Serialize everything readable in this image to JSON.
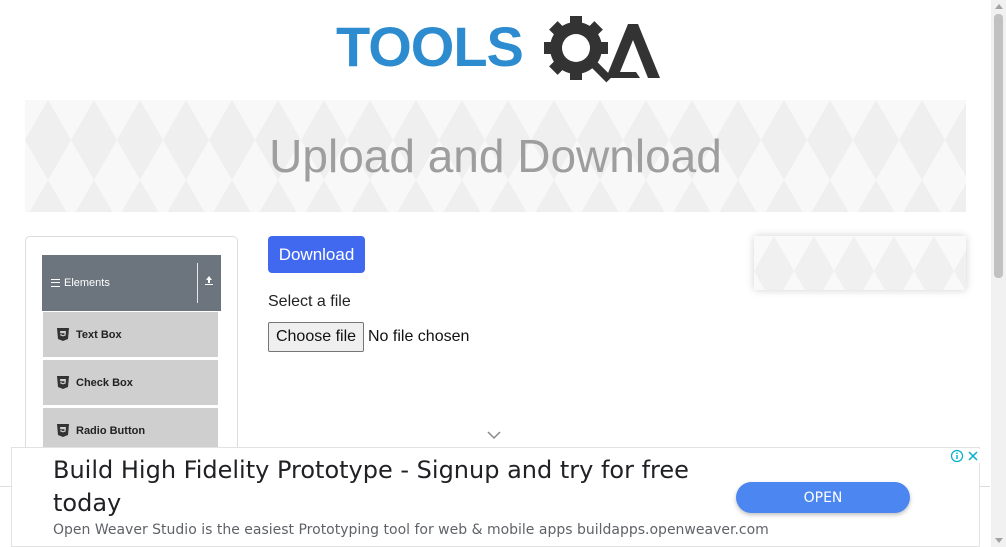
{
  "header": {
    "logo_text": "TOOLSQA",
    "brand_color": "#2d8ccf",
    "dark_color": "#333333"
  },
  "banner": {
    "title": "Upload and Download"
  },
  "sidebar": {
    "group": {
      "label": "Elements",
      "icon": "menu-icon",
      "toggle_icon": "collapse-icon"
    },
    "items": [
      {
        "label": "Text Box",
        "icon": "html5-icon"
      },
      {
        "label": "Check Box",
        "icon": "html5-icon"
      },
      {
        "label": "Radio Button",
        "icon": "html5-icon"
      }
    ]
  },
  "main": {
    "download_label": "Download",
    "select_label": "Select a file",
    "choose_file_label": "Choose file",
    "no_file_text": "No file chosen"
  },
  "ad": {
    "headline": "Build High Fidelity Prototype - Signup and try for free today",
    "description": "Open Weaver Studio is the easiest Prototyping tool for web & mobile apps buildapps.openweaver.com",
    "button_label": "OPEN",
    "button_color": "#4c86f0"
  },
  "colors": {
    "primary_button": "#4169f0",
    "sidebar_header": "#6c757d",
    "menu_item_bg": "#cfcfcf"
  }
}
